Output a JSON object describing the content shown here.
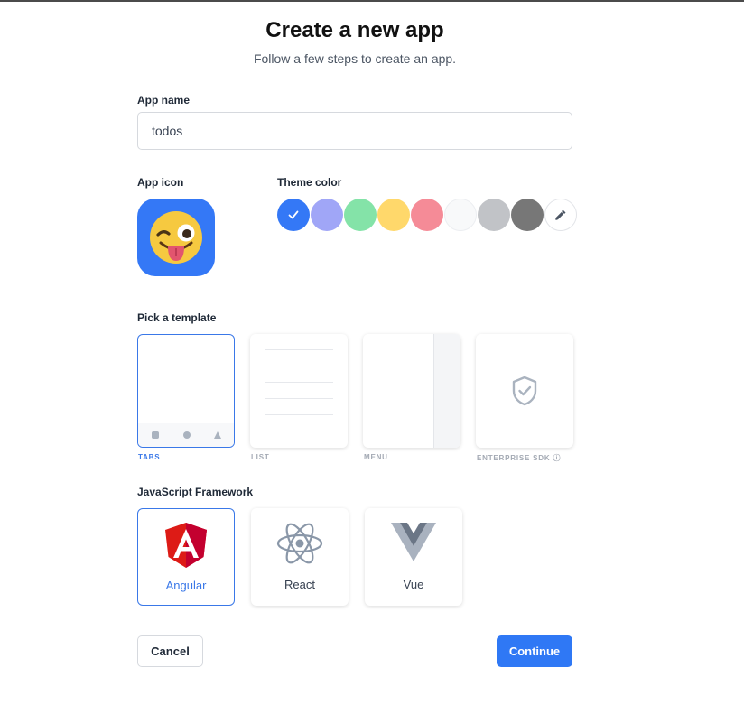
{
  "header": {
    "title": "Create a new app",
    "subtitle": "Follow a few steps to create an app."
  },
  "app_name": {
    "label": "App name",
    "value": "todos"
  },
  "app_icon": {
    "label": "App icon",
    "icon": "winking-face-with-tongue-icon",
    "background": "#3478f6"
  },
  "theme_color": {
    "label": "Theme color",
    "selected_index": 0,
    "swatches": [
      "#3478f6",
      "#a0a6f7",
      "#84e3a8",
      "#ffd86b",
      "#f58b97",
      "#f8f9fa",
      "#c1c3c7",
      "#777777"
    ],
    "picker_icon": "eyedropper-icon"
  },
  "templates": {
    "label": "Pick a template",
    "items": [
      {
        "caption": "TABS",
        "selected": true
      },
      {
        "caption": "LIST",
        "selected": false
      },
      {
        "caption": "MENU",
        "selected": false
      },
      {
        "caption": "ENTERPRISE SDK ⓘ",
        "selected": false
      }
    ]
  },
  "framework": {
    "label": "JavaScript Framework",
    "items": [
      {
        "label": "Angular",
        "icon": "angular-logo-icon",
        "selected": true
      },
      {
        "label": "React",
        "icon": "react-logo-icon",
        "selected": false
      },
      {
        "label": "Vue",
        "icon": "vue-logo-icon",
        "selected": false
      }
    ]
  },
  "actions": {
    "cancel": "Cancel",
    "continue": "Continue"
  }
}
